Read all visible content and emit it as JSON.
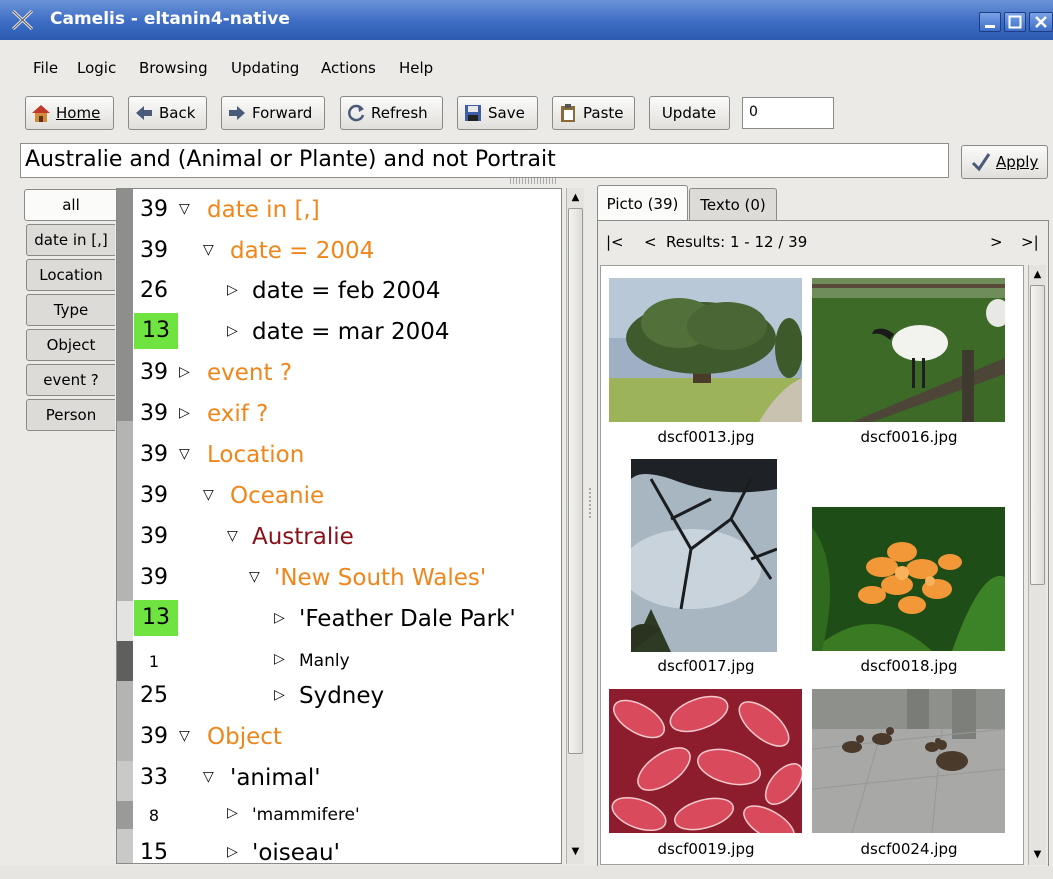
{
  "window": {
    "title": "Camelis - eltanin4-native"
  },
  "menu": [
    "File",
    "Logic",
    "Browsing",
    "Updating",
    "Actions",
    "Help"
  ],
  "toolbar": {
    "home": "Home",
    "back": "Back",
    "forward": "Forward",
    "refresh": "Refresh",
    "save": "Save",
    "paste": "Paste",
    "update": "Update",
    "count_value": "0"
  },
  "query": {
    "value": "Australie and (Animal or Plante) and not Portrait",
    "apply_label": "Apply"
  },
  "side_tabs": [
    "all",
    "date in [,]",
    "Location",
    "Type",
    "Object",
    "event ?",
    "Person"
  ],
  "tree": [
    {
      "count": "39",
      "label": "date in [,]",
      "style": "orange",
      "expanded": true
    },
    {
      "count": "39",
      "label": "date = 2004",
      "style": "orange",
      "expanded": true
    },
    {
      "count": "26",
      "label": "date = feb 2004",
      "style": "black",
      "expanded": false
    },
    {
      "count": "13",
      "label": "date = mar 2004",
      "style": "black",
      "expanded": false,
      "highlight": true
    },
    {
      "count": "39",
      "label": "event ?",
      "style": "orange",
      "expanded": false
    },
    {
      "count": "39",
      "label": "exif ?",
      "style": "orange",
      "expanded": false
    },
    {
      "count": "39",
      "label": "Location",
      "style": "orange",
      "expanded": true
    },
    {
      "count": "39",
      "label": "Oceanie",
      "style": "orange",
      "expanded": true
    },
    {
      "count": "39",
      "label": "Australie",
      "style": "darkred",
      "expanded": true
    },
    {
      "count": "39",
      "label": "'New South Wales'",
      "style": "orange",
      "expanded": true
    },
    {
      "count": "13",
      "label": "'Feather Dale Park'",
      "style": "black",
      "expanded": false,
      "highlight": true
    },
    {
      "count": "1",
      "label": "Manly",
      "style": "black-small",
      "expanded": false
    },
    {
      "count": "25",
      "label": "Sydney",
      "style": "black",
      "expanded": false
    },
    {
      "count": "39",
      "label": "Object",
      "style": "orange",
      "expanded": true
    },
    {
      "count": "33",
      "label": "'animal'",
      "style": "black",
      "expanded": true
    },
    {
      "count": "8",
      "label": "'mammifere'",
      "style": "black-small",
      "expanded": false
    },
    {
      "count": "15",
      "label": "'oiseau'",
      "style": "black",
      "expanded": false
    }
  ],
  "results": {
    "tabs": [
      "Picto (39)",
      "Texto (0)"
    ],
    "nav": {
      "first": "|<",
      "prev": "<",
      "status": "Results: 1 - 12 / 39",
      "next": ">",
      "last": ">|"
    },
    "thumbnails": [
      "dscf0013.jpg",
      "dscf0016.jpg",
      "dscf0017.jpg",
      "dscf0018.jpg",
      "dscf0019.jpg",
      "dscf0024.jpg"
    ]
  }
}
